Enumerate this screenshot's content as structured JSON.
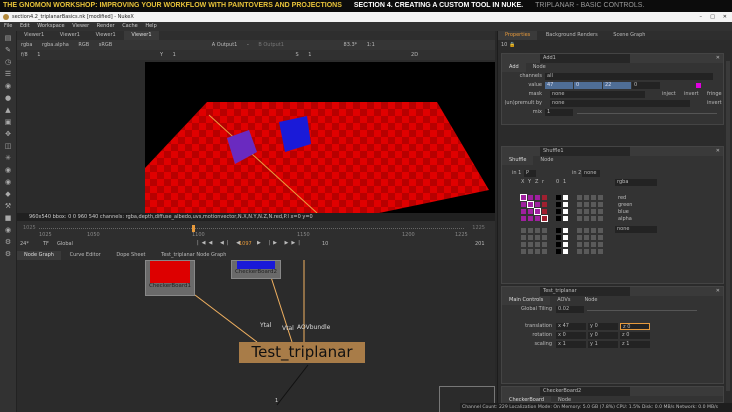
{
  "banner": {
    "title": "THE GNOMON WORKSHOP: IMPROVING YOUR WORKFLOW WITH PAINTOVERS AND PROJECTIONS",
    "section": "SECTION 4. CREATING A CUSTOM TOOL IN NUKE.",
    "topic": "TRIPLANAR - BASIC CONTROLS."
  },
  "window": {
    "title": "section4.2_triplanarBasics.nk [modified] - NukeX"
  },
  "menu": [
    "File",
    "Edit",
    "Workspace",
    "Viewer",
    "Render",
    "Cache",
    "Help"
  ],
  "viewer": {
    "tabs": [
      "Viewer1",
      "Viewer1",
      "Viewer1",
      "Viewer1"
    ],
    "toolbar": {
      "channels": "rgba",
      "alpha": "rgba.alpha",
      "display": "RGB",
      "lut": "sRGB",
      "input_a": "A  Output1",
      "dash": "-",
      "input_b": "B  Output1",
      "zoom": "83.3*",
      "ratio": "1:1",
      "mode": "2D"
    },
    "row2": {
      "fstop": "f/8",
      "gain": "1",
      "gamma_label": "Y",
      "gamma": "1",
      "sat_label": "S",
      "sat": "1"
    },
    "info": "960x540   bbox: 0 0 960 540 channels: rgba,depth,diffuse_albedo,uvs,motionvector,N.X,N.Y,N.Z,N.red,P.l   x=0 y=0"
  },
  "timeline": {
    "start": "1025",
    "end": "1225",
    "ticks": [
      "1025",
      "1050",
      "1100",
      "1150",
      "1200",
      "1225"
    ],
    "current": "1097",
    "fps": "24*",
    "tf": "TF",
    "scope": "Global",
    "step": "10",
    "frames": "201",
    "playhead": 0.36
  },
  "nodegraph": {
    "tabs": [
      "Node Graph",
      "Curve Editor",
      "Dope Sheet",
      "Test_triplanar Node Graph"
    ],
    "nodes": {
      "cb1": "CheckerBoard1",
      "cb2": "CheckerBoard2",
      "main": "Test_triplanar"
    },
    "inputs": [
      "Ytal",
      "Vtal",
      "AOVbundle"
    ],
    "output": "1"
  },
  "properties": {
    "tabs": [
      "Properties",
      "Background Renders",
      "Scene Graph"
    ],
    "count": "10",
    "add": {
      "name": "Add1",
      "tabs": [
        "Add",
        "Node"
      ],
      "channels_label": "channels",
      "channels": "all",
      "value_label": "value",
      "value": [
        "47",
        "0",
        "22",
        "0"
      ],
      "mask_label": "mask",
      "mask": "none",
      "inject": "inject",
      "invert": "invert",
      "fringe": "fringe",
      "premult_label": "(un)premult by",
      "premult": "none",
      "invert2": "invert",
      "mix_label": "mix",
      "mix": "1"
    },
    "shuffle": {
      "name": "Shuffle1",
      "tabs": [
        "Shuffle",
        "Node"
      ],
      "in1_label": "in 1",
      "in1": "P",
      "in2_label": "in 2",
      "in2": "none",
      "col_labels": [
        "X",
        "Y",
        "Z",
        "r",
        "0",
        "1"
      ],
      "out1": "rgba",
      "out2": "none",
      "outputs": [
        "red",
        "green",
        "blue",
        "alpha"
      ]
    },
    "triplanar": {
      "name": "Test_triplanar",
      "tabs": [
        "Main Controls",
        "AOVs",
        "Node"
      ],
      "tiling_label": "Global Tiling",
      "tiling": "0.02",
      "rows": [
        {
          "label": "translation",
          "x": "47",
          "y": "0",
          "z": "0"
        },
        {
          "label": "rotation",
          "x": "0",
          "y": "0",
          "z": "0"
        },
        {
          "label": "scaling",
          "x": "1",
          "y": "1",
          "z": "1"
        }
      ]
    },
    "checker2": {
      "name": "CheckerBoard2",
      "tabs": [
        "CheckerBoard",
        "Node"
      ]
    }
  },
  "status": "Channel Count: 229  Localization Mode: On  Memory: 5.0 GB (7.8%)  CPU: 1.5%  Disk: 0.0 MB/s  Network: 0.0 MB/s",
  "colors": {
    "accent": "#e79a3c",
    "banner_yellow": "#e8c33a",
    "node": "#f0b060",
    "checker_red": "#e00000",
    "cube": "#1a1ad8"
  }
}
